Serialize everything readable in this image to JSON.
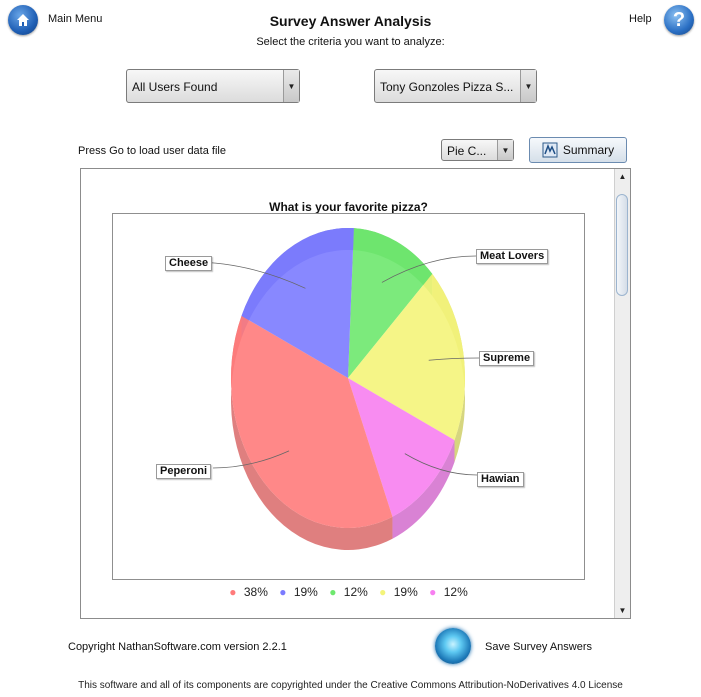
{
  "header": {
    "main_menu_label": "Main Menu",
    "help_label": "Help",
    "title": "Survey Answer Analysis",
    "subtitle": "Select the criteria you want to analyze:"
  },
  "filters": {
    "user_select": "All Users Found",
    "survey_select": "Tony Gonzoles Pizza S..."
  },
  "controls": {
    "prompt": "Press Go to load user data file",
    "chart_type_select": "Pie C...",
    "summary_button": "Summary"
  },
  "chart_data": {
    "type": "pie",
    "title": "What is your favorite pizza?",
    "slices": [
      {
        "label": "Peperoni",
        "percent": 38,
        "color": "#ff7b7b"
      },
      {
        "label": "Cheese",
        "percent": 19,
        "color": "#7b7bff"
      },
      {
        "label": "Meat Lovers",
        "percent": 12,
        "color": "#6ee86e"
      },
      {
        "label": "Supreme",
        "percent": 19,
        "color": "#f4f47a"
      },
      {
        "label": "Hawian",
        "percent": 12,
        "color": "#f77ff0"
      }
    ],
    "legend": [
      "38%",
      "19%",
      "12%",
      "19%",
      "12%"
    ],
    "legend_placement": "bottom",
    "style": "3d"
  },
  "footer": {
    "copyright": "Copyright NathanSoftware.com version 2.2.1",
    "save_label": "Save Survey Answers",
    "license": "This software and all of its components are copyrighted under the Creative Commons Attribution-NoDerivatives 4.0 License"
  },
  "icons": {
    "home": "home-icon",
    "help": "question-icon",
    "summary": "summary-icon",
    "save": "save-icon"
  }
}
